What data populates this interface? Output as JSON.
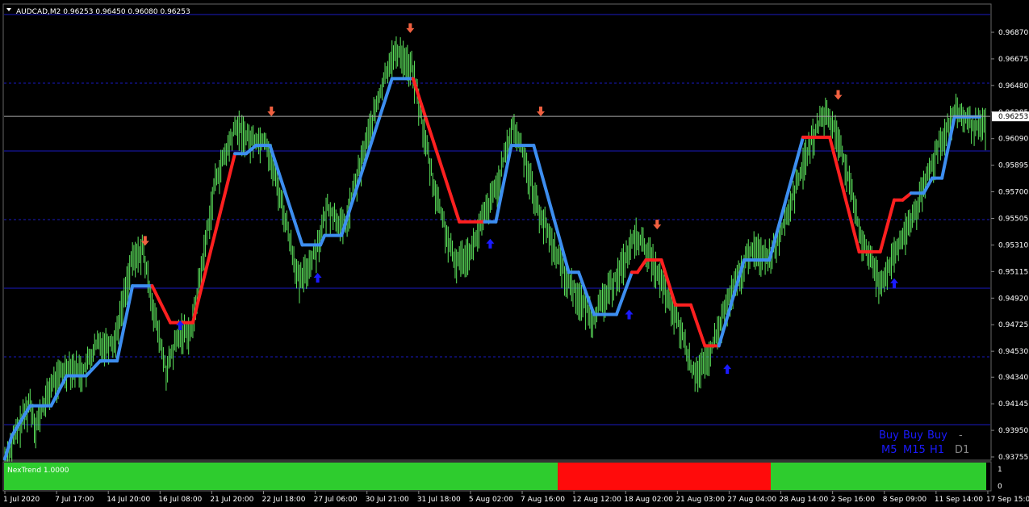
{
  "chart": {
    "symbol_line": "AUDCAD,M2  0.96253 0.96450 0.96080 0.96253",
    "current_price": "0.96253",
    "colors": {
      "bull_bar": "#5ee85e",
      "trend_up": "#3d8ef0",
      "trend_down": "#ff2020",
      "arrow_up": "#1a1aff",
      "arrow_down": "#f06040",
      "grid_line": "#1a1abf"
    },
    "signal_panel": {
      "signals": [
        "Buy",
        "Buy",
        "Buy",
        "-"
      ],
      "timeframes": [
        "M5",
        "M15",
        "H1",
        "D1"
      ]
    }
  },
  "indicator": {
    "label": "NexTrend 1.0000",
    "scale": [
      "1",
      "0"
    ],
    "colors": {
      "on": "#2ecc2e",
      "off": "#ff0b0b"
    }
  },
  "chart_data": {
    "type": "ohlc",
    "y_axis_ticks": [
      "0.96870",
      "0.96675",
      "0.96480",
      "0.96285",
      "0.96090",
      "0.95895",
      "0.95700",
      "0.95505",
      "0.95310",
      "0.95115",
      "0.94920",
      "0.94725",
      "0.94530",
      "0.94340",
      "0.94145",
      "0.93950",
      "0.93755"
    ],
    "x_axis_ticks": [
      "1 Jul 2020",
      "7 Jul 17:00",
      "14 Jul 20:00",
      "16 Jul 08:00",
      "21 Jul 20:00",
      "22 Jul 18:00",
      "27 Jul 06:00",
      "30 Jul 21:00",
      "31 Jul 18:00",
      "5 Aug 02:00",
      "7 Aug 16:00",
      "12 Aug 12:00",
      "18 Aug 02:00",
      "21 Aug 03:00",
      "27 Aug 04:00",
      "28 Aug 14:00",
      "2 Sep 16:00",
      "8 Sep 09:00",
      "11 Sep 14:00",
      "17 Sep 15:00"
    ],
    "ylim": [
      0.9368,
      0.9709
    ],
    "trend_line": [
      [
        0,
        0.9374
      ],
      [
        5,
        0.9391
      ],
      [
        18,
        0.9413
      ],
      [
        33,
        0.9413
      ],
      [
        44,
        0.9435
      ],
      [
        58,
        0.9435
      ],
      [
        68,
        0.9446
      ],
      [
        80,
        0.9446
      ],
      [
        91,
        0.9501
      ],
      [
        105,
        0.9501
      ],
      [
        118,
        0.9474
      ],
      [
        134,
        0.9474
      ],
      [
        164,
        0.9598
      ],
      [
        172,
        0.9598
      ],
      [
        179,
        0.9604
      ],
      [
        189,
        0.9604
      ],
      [
        212,
        0.9531
      ],
      [
        225,
        0.9531
      ],
      [
        228,
        0.9538
      ],
      [
        240,
        0.9538
      ],
      [
        276,
        0.9653
      ],
      [
        291,
        0.9653
      ],
      [
        324,
        0.9548
      ],
      [
        340,
        0.9548
      ],
      [
        342,
        0.9548
      ],
      [
        350,
        0.9548
      ],
      [
        361,
        0.9604
      ],
      [
        377,
        0.9604
      ],
      [
        402,
        0.9511
      ],
      [
        409,
        0.9511
      ],
      [
        420,
        0.948
      ],
      [
        436,
        0.948
      ],
      [
        447,
        0.9511
      ],
      [
        451,
        0.9511
      ],
      [
        457,
        0.952
      ],
      [
        468,
        0.952
      ],
      [
        478,
        0.9487
      ],
      [
        489,
        0.9487
      ],
      [
        499,
        0.9457
      ],
      [
        509,
        0.9457
      ],
      [
        527,
        0.952
      ],
      [
        545,
        0.952
      ],
      [
        569,
        0.961
      ],
      [
        588,
        0.961
      ],
      [
        609,
        0.9526
      ],
      [
        624,
        0.9526
      ],
      [
        634,
        0.9564
      ],
      [
        640,
        0.9564
      ],
      [
        646,
        0.9569
      ],
      [
        655,
        0.9569
      ],
      [
        661,
        0.958
      ],
      [
        668,
        0.958
      ],
      [
        677,
        0.9625
      ],
      [
        695,
        0.9625
      ]
    ],
    "trend_dir": [
      "u",
      "u",
      "u",
      "u",
      "u",
      "u",
      "u",
      "u",
      "u",
      "d",
      "d",
      "d",
      "u",
      "u",
      "u",
      "u",
      "u",
      "u",
      "u",
      "u",
      "u",
      "d",
      "d",
      "d",
      "u",
      "u",
      "u",
      "u",
      "u",
      "u",
      "u",
      "u",
      "d",
      "d",
      "d",
      "d",
      "d",
      "d",
      "d",
      "u",
      "u",
      "u",
      "d",
      "d",
      "d",
      "d",
      "d",
      "d",
      "u",
      "u",
      "u",
      "u",
      "u",
      "u",
      "d",
      "d",
      "d",
      "u",
      "u",
      "u",
      "u",
      "u",
      "u",
      "u"
    ],
    "up_arrows": [
      [
        125,
        0.9472
      ],
      [
        223,
        0.9507
      ],
      [
        346,
        0.9532
      ],
      [
        445,
        0.948
      ],
      [
        515,
        0.944
      ],
      [
        634,
        0.9503
      ]
    ],
    "down_arrows": [
      [
        100,
        0.9534
      ],
      [
        190,
        0.9629
      ],
      [
        289,
        0.969
      ],
      [
        382,
        0.9629
      ],
      [
        465,
        0.9546
      ],
      [
        594,
        0.9641
      ]
    ],
    "bar_count": 700,
    "bar_minutes": 120,
    "waypoints": [
      [
        0,
        0.9376
      ],
      [
        18,
        0.9418
      ],
      [
        22,
        0.94
      ],
      [
        33,
        0.943
      ],
      [
        46,
        0.9445
      ],
      [
        56,
        0.944
      ],
      [
        66,
        0.946
      ],
      [
        78,
        0.9462
      ],
      [
        90,
        0.952
      ],
      [
        98,
        0.953
      ],
      [
        108,
        0.9475
      ],
      [
        115,
        0.944
      ],
      [
        125,
        0.947
      ],
      [
        133,
        0.947
      ],
      [
        150,
        0.958
      ],
      [
        165,
        0.962
      ],
      [
        175,
        0.961
      ],
      [
        186,
        0.961
      ],
      [
        196,
        0.957
      ],
      [
        210,
        0.9505
      ],
      [
        222,
        0.953
      ],
      [
        230,
        0.956
      ],
      [
        242,
        0.9545
      ],
      [
        258,
        0.961
      ],
      [
        275,
        0.967
      ],
      [
        282,
        0.9675
      ],
      [
        291,
        0.966
      ],
      [
        305,
        0.958
      ],
      [
        320,
        0.952
      ],
      [
        333,
        0.953
      ],
      [
        340,
        0.955
      ],
      [
        352,
        0.958
      ],
      [
        362,
        0.962
      ],
      [
        370,
        0.96
      ],
      [
        380,
        0.956
      ],
      [
        400,
        0.951
      ],
      [
        412,
        0.949
      ],
      [
        420,
        0.948
      ],
      [
        436,
        0.951
      ],
      [
        450,
        0.954
      ],
      [
        460,
        0.9525
      ],
      [
        472,
        0.9495
      ],
      [
        482,
        0.947
      ],
      [
        490,
        0.944
      ],
      [
        500,
        0.9445
      ],
      [
        515,
        0.949
      ],
      [
        532,
        0.953
      ],
      [
        545,
        0.9525
      ],
      [
        556,
        0.955
      ],
      [
        575,
        0.961
      ],
      [
        585,
        0.963
      ],
      [
        595,
        0.961
      ],
      [
        610,
        0.954
      ],
      [
        624,
        0.9505
      ],
      [
        634,
        0.9525
      ],
      [
        650,
        0.956
      ],
      [
        667,
        0.961
      ],
      [
        678,
        0.963
      ],
      [
        690,
        0.962
      ],
      [
        699,
        0.962
      ]
    ]
  }
}
